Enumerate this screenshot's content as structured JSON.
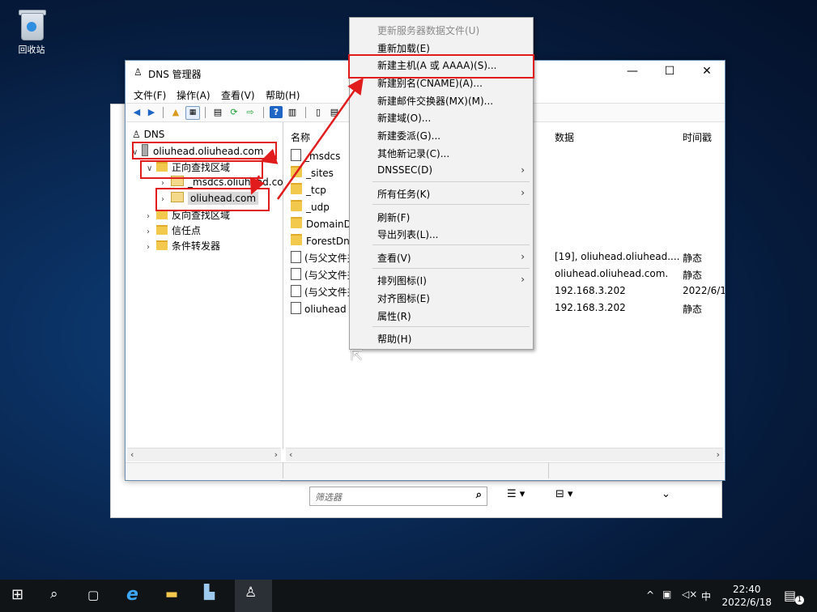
{
  "desktop": {
    "recycle_bin_label": "回收站"
  },
  "window": {
    "title": "DNS 管理器",
    "controls": {
      "minimize": "—",
      "maximize": "☐",
      "close": "✕"
    },
    "menu": [
      "文件(F)",
      "操作(A)",
      "查看(V)",
      "帮助(H)"
    ]
  },
  "tree": {
    "root": "DNS",
    "server": "oliuhead.oliuhead.com",
    "forward_zones": "正向查找区域",
    "msdcs": "_msdcs.oliuhead.co",
    "zone": "oliuhead.com",
    "reverse_zones": "反向查找区域",
    "trust_points": "信任点",
    "conditional_forwarders": "条件转发器"
  },
  "list": {
    "headers": {
      "name": "名称",
      "data": "数据",
      "timestamp": "时间戳"
    },
    "rows": [
      {
        "name": "_msdcs",
        "data": "",
        "timestamp": ""
      },
      {
        "name": "_sites",
        "data": "",
        "timestamp": ""
      },
      {
        "name": "_tcp",
        "data": "",
        "timestamp": ""
      },
      {
        "name": "_udp",
        "data": "",
        "timestamp": ""
      },
      {
        "name": "DomainDn",
        "data": "",
        "timestamp": ""
      },
      {
        "name": "ForestDns",
        "data": "",
        "timestamp": ""
      },
      {
        "name": "(与父文件夹",
        "data": "[19], oliuhead.oliuhead....",
        "timestamp": "静态"
      },
      {
        "name": "(与父文件夹",
        "data": "oliuhead.oliuhead.com.",
        "timestamp": "静态"
      },
      {
        "name": "(与父文件夹",
        "data": "192.168.3.202",
        "timestamp": "2022/6/1"
      },
      {
        "name": "oliuhead",
        "data": "192.168.3.202",
        "timestamp": "静态"
      }
    ]
  },
  "context_menu": {
    "items": [
      {
        "label": "更新服务器数据文件(U)",
        "disabled": true
      },
      {
        "label": "重新加载(E)"
      },
      {
        "label": "新建主机(A 或 AAAA)(S)..."
      },
      {
        "label": "新建别名(CNAME)(A)..."
      },
      {
        "label": "新建邮件交换器(MX)(M)..."
      },
      {
        "label": "新建域(O)..."
      },
      {
        "label": "新建委派(G)..."
      },
      {
        "label": "其他新记录(C)..."
      },
      {
        "label": "DNSSEC(D)",
        "submenu": true
      },
      {
        "label": "所有任务(K)",
        "submenu": true
      },
      {
        "label": "刷新(F)"
      },
      {
        "label": "导出列表(L)..."
      },
      {
        "label": "查看(V)",
        "submenu": true
      },
      {
        "label": "排列图标(I)",
        "submenu": true
      },
      {
        "label": "对齐图标(E)"
      },
      {
        "label": "属性(R)"
      },
      {
        "label": "帮助(H)"
      }
    ]
  },
  "filter": {
    "placeholder": "筛选器"
  },
  "taskbar": {
    "ime": "中",
    "time": "22:40",
    "date": "2022/6/18",
    "notification_count": "1"
  },
  "colors": {
    "highlight": "#e11c1c",
    "taskbar": "#101417"
  }
}
